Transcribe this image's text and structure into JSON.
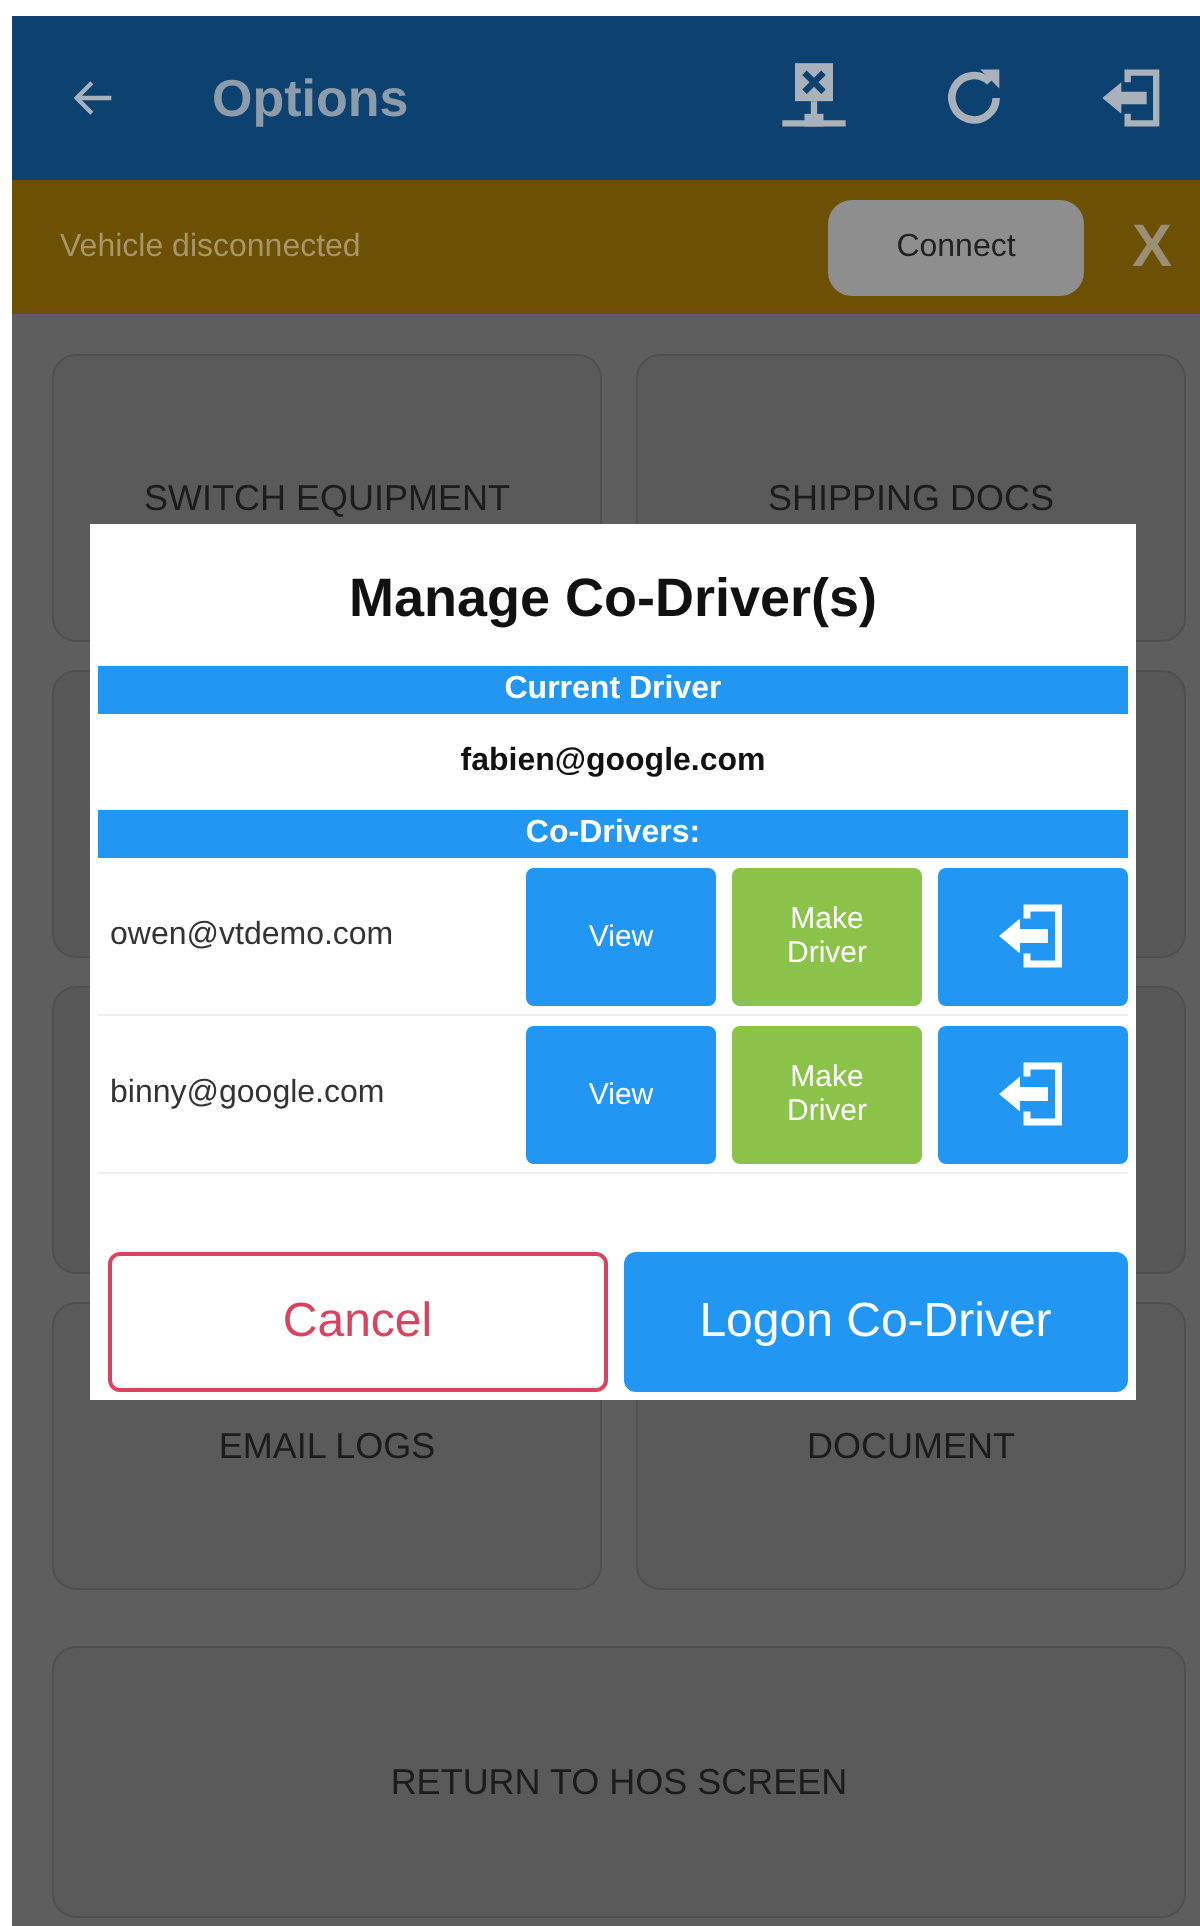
{
  "app_bar": {
    "title": "Options"
  },
  "banner": {
    "message": "Vehicle disconnected",
    "button": "Connect",
    "close": "X"
  },
  "tiles": [
    {
      "kind": "labeled",
      "label": "SWITCH EQUIPMENT"
    },
    {
      "kind": "labeled",
      "label": "SHIPPING DOCS"
    },
    {
      "kind": "covered"
    },
    {
      "kind": "covered"
    },
    {
      "kind": "covered"
    },
    {
      "kind": "covered"
    },
    {
      "kind": "labeled",
      "label": "EMAIL LOGS"
    },
    {
      "kind": "labeled",
      "label": "DOCUMENT"
    }
  ],
  "wide_tile": {
    "label": "RETURN TO HOS SCREEN"
  },
  "dialog": {
    "title": "Manage Co-Driver(s)",
    "current_header": "Current Driver",
    "current_driver": "fabien@google.com",
    "codrivers_header": "Co-Drivers:",
    "codrivers": [
      {
        "email": "owen@vtdemo.com",
        "view": "View",
        "make": "Make Driver"
      },
      {
        "email": "binny@google.com",
        "view": "View",
        "make": "Make Driver"
      }
    ],
    "cancel": "Cancel",
    "logon": "Logon Co-Driver"
  }
}
